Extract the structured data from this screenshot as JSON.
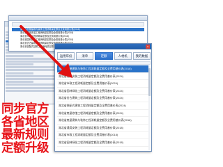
{
  "main_dialog": {
    "tabs": [
      {
        "label": "运用年份"
      },
      {
        "label": "清单"
      },
      {
        "label": "定额"
      },
      {
        "label": "人材机"
      },
      {
        "label": "我的数据"
      }
    ],
    "active_tab": 2,
    "items": [
      {
        "label": "湖北省房屋建筑与装饰工程消耗量定额及全费用基价表(2018)",
        "selected": true
      },
      {
        "label": "湖北省通用安装工程消耗量定额及全费用基价表(2024)",
        "selected": false
      },
      {
        "label": "湖北省市政工程消耗量定额及全费用基价表(2024)",
        "selected": false
      },
      {
        "label": "湖北省园林绿化工程消耗量定额及全费用基价表(2024)",
        "selected": false
      },
      {
        "label": "湖北省仿古建筑工程消耗量定额及全费用基价表(2024)",
        "selected": false
      },
      {
        "label": "湖北省装配式建筑工程消耗量定额及全费用基价表(2024)",
        "selected": false
      },
      {
        "label": "湖北省房屋修缮工程消耗量定额及全费用基价表(2024)",
        "selected": false
      },
      {
        "label": "湖北省房屋建筑与装饰工程消耗量定额及全费用基价表(2018)",
        "selected": false
      },
      {
        "label": "湖北省通用安装工程消耗量定额及全费用基价表(2018)",
        "selected": false
      },
      {
        "label": "湖北省市政工程消耗量定额及全费用基价表(2018)",
        "selected": false
      },
      {
        "label": "湖北省园林绿化工程消耗量定额及全费用基价表(2018)",
        "selected": false
      }
    ]
  },
  "top_dialog": {
    "items": [
      {
        "label": "湖北省房屋建筑与装饰工程消耗量定额及全费用基价表(2018)",
        "selected": true
      },
      {
        "label": "湖北省通用安装工程消耗量定额及全费用基价表(2018)",
        "selected": false
      },
      {
        "label": "湖北省市政工程消耗量定额及全费用基价表(2018)",
        "selected": false
      },
      {
        "label": "湖北省园林绿化工程消耗量定额及全费用基价表(2018)",
        "selected": false
      },
      {
        "label": "湖北省仿古建筑工程消耗量定额及全费用基价表(2018)",
        "selected": false
      },
      {
        "label": "湖北省装配式建筑工程消耗量定额及全费用基价表(2018)",
        "selected": false
      }
    ]
  },
  "overlay": {
    "lines": [
      "同步官方",
      "各省地区",
      "最新规则",
      "定额升级"
    ],
    "color": "#e8141a"
  },
  "colors": {
    "accent": "#2a73c9",
    "title_bar": "#1f5aa6",
    "arrow": "#e01010"
  }
}
